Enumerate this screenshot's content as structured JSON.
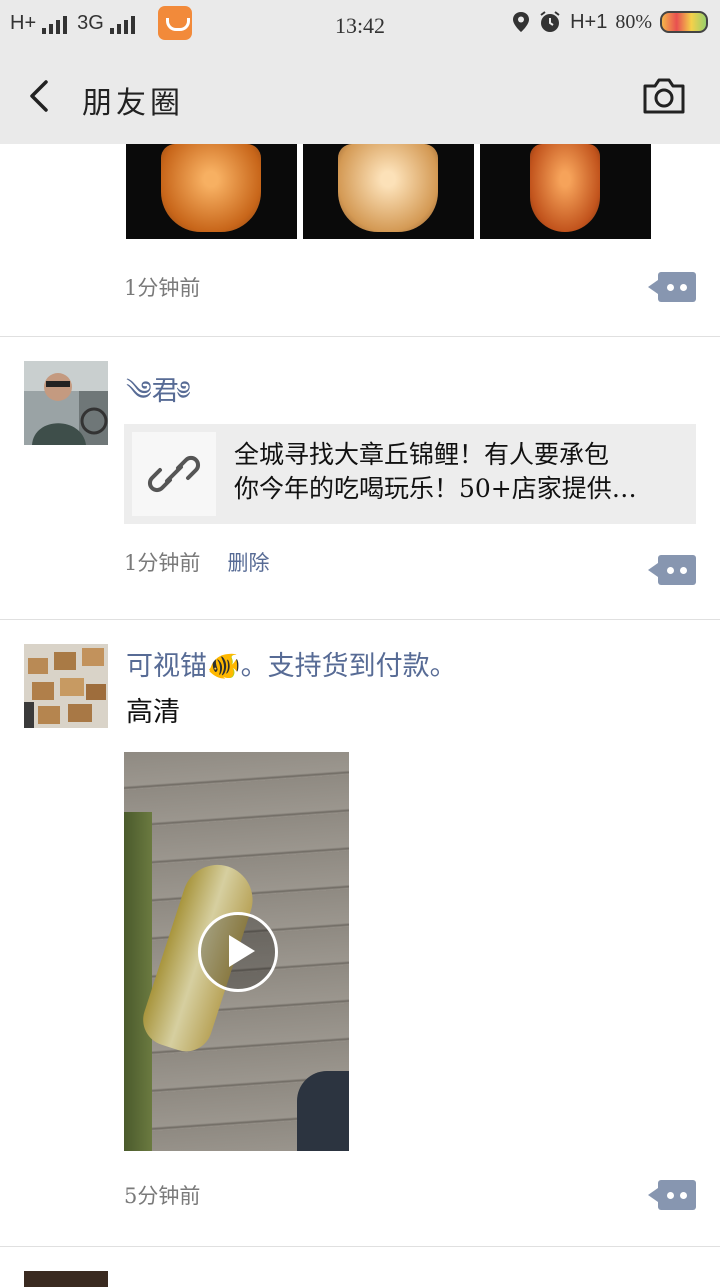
{
  "status_bar": {
    "network_1": "H+",
    "network_2": "3G",
    "time": "13:42",
    "network_3": "H+1",
    "battery": "80%"
  },
  "header": {
    "title": "朋友圈"
  },
  "posts": [
    {
      "time": "1分钟前"
    },
    {
      "user": "༄君༅",
      "link_title_line1": "全城寻找大章丘锦鲤！有人要承包",
      "link_title_line2": "你今年的吃喝玩乐！50+店家提供…",
      "time": "1分钟前",
      "delete": "删除"
    },
    {
      "user": "可视锚🐠。支持货到付款。",
      "text": "高清",
      "time": "5分钟前"
    }
  ],
  "icons": {
    "back": "chevron-left-icon",
    "camera": "camera-icon",
    "comment": "comment-dots-icon",
    "link": "link-icon",
    "play": "play-icon"
  }
}
